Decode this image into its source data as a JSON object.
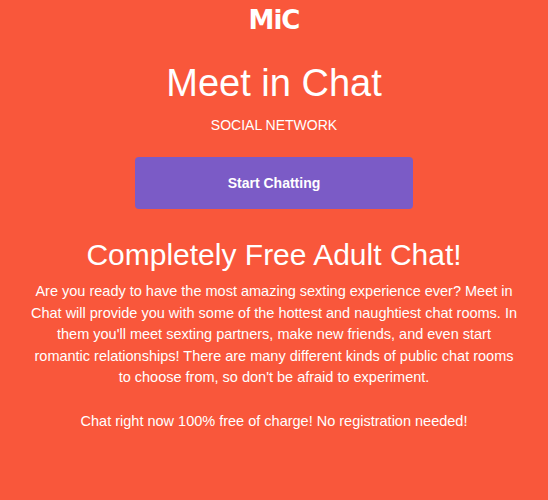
{
  "logo": "MiC",
  "title": "Meet in Chat",
  "subtitle": "SOCIAL NETWORK",
  "button": "Start Chatting",
  "heading": "Completely Free Adult Chat!",
  "paragraph": "Are you ready to have the most amazing sexting experience ever? Meet in Chat will provide you with some of the hottest and naughtiest chat rooms. In them you'll meet sexting partners, make new friends, and even start romantic relationships! There are many different kinds of public chat rooms to choose from, so don't be afraid to experiment.",
  "footer": "Chat right now 100% free of charge! No registration needed!"
}
